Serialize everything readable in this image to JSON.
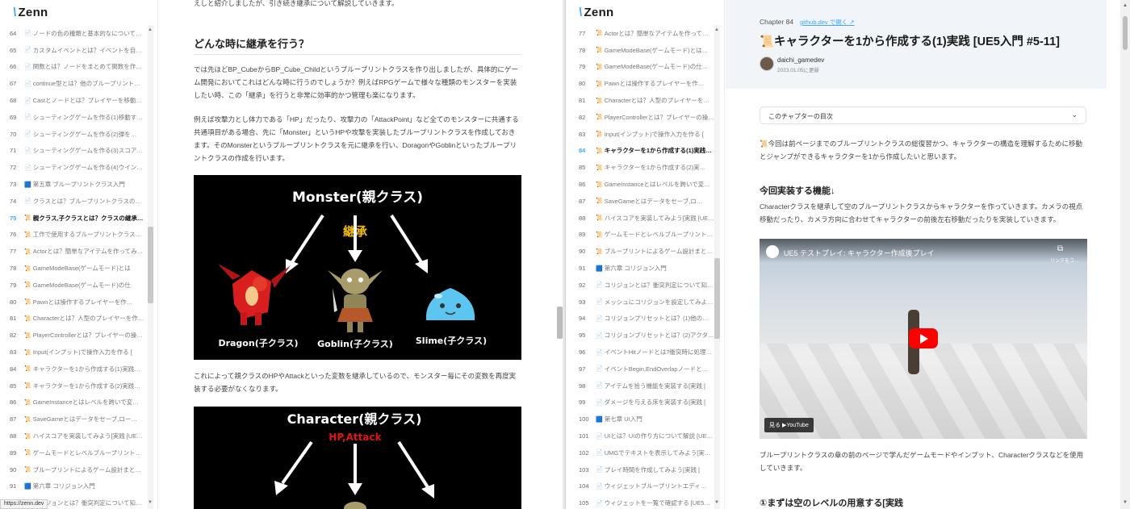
{
  "brand": {
    "slash": "\\",
    "name": "Zenn"
  },
  "left": {
    "chapters": [
      {
        "num": "64",
        "icon": "📄",
        "title": "ノードの色の種類と基本的なについて…",
        "active": false
      },
      {
        "num": "65",
        "icon": "📄",
        "title": "カスタムイベントとは？イベントを自…",
        "active": false
      },
      {
        "num": "66",
        "icon": "📄",
        "title": "関数とは？ノードをまとめて関数を作…",
        "active": false
      },
      {
        "num": "67",
        "icon": "📄",
        "title": "continue型とは？他のブループリントクラ…",
        "active": false
      },
      {
        "num": "68",
        "icon": "📄",
        "title": "Castとノードとは？プレイヤーを移動…",
        "active": false
      },
      {
        "num": "69",
        "icon": "📄",
        "title": "シューティングゲームを作る(1)移動す…",
        "active": false
      },
      {
        "num": "70",
        "icon": "📄",
        "title": "シューティングゲームを作る(2)弾を…",
        "active": false
      },
      {
        "num": "71",
        "icon": "📄",
        "title": "シューティングゲームを作る(3)スコア…",
        "active": false
      },
      {
        "num": "72",
        "icon": "📄",
        "title": "シューティングゲームを作る(4)ウイン…",
        "active": false
      },
      {
        "num": "73",
        "icon": "🟦",
        "title": "第五章 ブループリントクラス入門",
        "active": false
      },
      {
        "num": "74",
        "icon": "📄",
        "title": "クラスとは？ブループリントクラスの…",
        "active": false
      },
      {
        "num": "75",
        "icon": "📜",
        "title": "親クラス,子クラスとは？クラスの継承…",
        "active": true
      },
      {
        "num": "76",
        "icon": "📜",
        "title": "工作で使用するブループリントクラス…",
        "active": false
      },
      {
        "num": "77",
        "icon": "📜",
        "title": "Actorとは？簡単なアイテムを作ってみ…",
        "active": false
      },
      {
        "num": "78",
        "icon": "📜",
        "title": "GameModeBase(ゲームモード)とは",
        "active": false
      },
      {
        "num": "79",
        "icon": "📜",
        "title": "GameModeBase(ゲームモード)の仕",
        "active": false
      },
      {
        "num": "80",
        "icon": "📜",
        "title": "Pawnとは操作するプレイヤーを作…",
        "active": false
      },
      {
        "num": "81",
        "icon": "📜",
        "title": "Characterとは？人型のプレイヤーを作…",
        "active": false
      },
      {
        "num": "82",
        "icon": "📜",
        "title": "PlayerControllerとは？プレイヤーの操…",
        "active": false
      },
      {
        "num": "83",
        "icon": "📜",
        "title": "Input(インプット)で操作入力を作る [",
        "active": false
      },
      {
        "num": "84",
        "icon": "📜",
        "title": "キャラクターを1から作成する(1)実践…",
        "active": false
      },
      {
        "num": "85",
        "icon": "📜",
        "title": "キャラクターを1から作成する(2)実践…",
        "active": false
      },
      {
        "num": "86",
        "icon": "📜",
        "title": "GameInstanceとはレベルを跨いで変…",
        "active": false
      },
      {
        "num": "87",
        "icon": "📜",
        "title": "SaveGameとはデータをセーブ,ロー…",
        "active": false
      },
      {
        "num": "88",
        "icon": "📜",
        "title": "ハイスコアを実装してみよう[実践 [UE…",
        "active": false
      },
      {
        "num": "89",
        "icon": "📜",
        "title": "ゲームモードとレベルブループリント…",
        "active": false
      },
      {
        "num": "90",
        "icon": "📜",
        "title": "ブループリントによるゲーム設計まと…",
        "active": false
      },
      {
        "num": "91",
        "icon": "🟦",
        "title": "第六章 コリジョン入門",
        "active": false
      },
      {
        "num": "92",
        "icon": "📄",
        "title": "コリジョンとは？衝突判定について知…",
        "active": false
      }
    ],
    "article": {
      "intro_line": "えしと紹介しましたが、引き続き継承について解説していきます。",
      "heading": "どんな時に継承を行う？",
      "para1": "では先ほどBP_CubeからBP_Cube_Childというブループリントクラスを作り出しましたが、具体的にゲーム開発においてこれはどんな時に行うのでしょうか？例えばRPGゲームで様々な種類のモンスターを実装したい時、この「継承」を行うと非常に効率的かつ管理も楽になります。",
      "para2": "例えば攻撃力とし体力である「HP」だったり、攻撃力の「AttackPoint」など全てのモンスターに共通する共通項目がある場合、先に「Monster」というHPや攻撃を実装したブループリントクラスを作成しておきます。そのMonsterというブループリントクラスを元に継承を行い、DoragonやGoblinといったブループリントクラスの作成を行います。",
      "para3": "これによって親クラスのHPやAttackといった変数を継承しているので、モンスター毎にその変数を再度実装する必要がなくなります。",
      "figure1": {
        "parent": "Monster(親クラス)",
        "inherit": "継承",
        "child1": "Dragon(子クラス)",
        "child2": "Goblin(子クラス)",
        "child3": "Slime(子クラス)"
      },
      "figure2": {
        "parent": "Character(親クラス)",
        "vars": "HP,Attack"
      }
    },
    "status_url": "https://zenn.dev"
  },
  "right": {
    "chapters": [
      {
        "num": "77",
        "icon": "📜",
        "title": "Actorとは？簡単なアイテムを作ってみ…",
        "active": false
      },
      {
        "num": "78",
        "icon": "📜",
        "title": "GameModeBase(ゲームモード)とは…",
        "active": false
      },
      {
        "num": "79",
        "icon": "📜",
        "title": "GameModeBase(ゲームモード)の仕…",
        "active": false
      },
      {
        "num": "80",
        "icon": "📜",
        "title": "Pawnとは操作するプレイヤーを作…",
        "active": false
      },
      {
        "num": "81",
        "icon": "📜",
        "title": "Characterとは？人型のプレイヤーを作…",
        "active": false
      },
      {
        "num": "82",
        "icon": "📜",
        "title": "PlayerControllerとは？プレイヤーの操…",
        "active": false
      },
      {
        "num": "83",
        "icon": "📜",
        "title": "Input(インプット)で操作入力を作る [",
        "active": false
      },
      {
        "num": "84",
        "icon": "📜",
        "title": "キャラクターを1から作成する(1)実践…",
        "active": true
      },
      {
        "num": "85",
        "icon": "📜",
        "title": "キャラクターを1から作成する(2)実…",
        "active": false
      },
      {
        "num": "86",
        "icon": "📜",
        "title": "GameInstanceとはレベルを跨いで変…",
        "active": false
      },
      {
        "num": "87",
        "icon": "📜",
        "title": "SaveGameとはデータをセーブ,ロ…",
        "active": false
      },
      {
        "num": "88",
        "icon": "📜",
        "title": "ハイスコアを実装してみよう[実践 [UE…",
        "active": false
      },
      {
        "num": "89",
        "icon": "📜",
        "title": "ゲームモードとレベルブループリント…",
        "active": false
      },
      {
        "num": "90",
        "icon": "📜",
        "title": "ブループリントによるゲーム設計まと…",
        "active": false
      },
      {
        "num": "91",
        "icon": "🟦",
        "title": "第六章 コリジョン入門",
        "active": false
      },
      {
        "num": "92",
        "icon": "📄",
        "title": "コリジョンとは？衝突判定について知…",
        "active": false
      },
      {
        "num": "93",
        "icon": "📄",
        "title": "メッシュにコリジョンを設定してみよ…",
        "active": false
      },
      {
        "num": "94",
        "icon": "📄",
        "title": "コリジョンプリセットとは？(1)他のア…",
        "active": false
      },
      {
        "num": "95",
        "icon": "📄",
        "title": "コリジョンプリセットとは？(2)アクタ…",
        "active": false
      },
      {
        "num": "96",
        "icon": "📄",
        "title": "イベントHitノードとは?衝突時に処理…",
        "active": false
      },
      {
        "num": "97",
        "icon": "📄",
        "title": "イベントBegin,EndOverlapノードと…",
        "active": false
      },
      {
        "num": "98",
        "icon": "📄",
        "title": "アイテムを拾う機能を実装する[実践 [",
        "active": false
      },
      {
        "num": "99",
        "icon": "📄",
        "title": "ダメージを与える床を実装する[実践 [",
        "active": false
      },
      {
        "num": "100",
        "icon": "🟦",
        "title": "第七章 UI入門",
        "active": false
      },
      {
        "num": "101",
        "icon": "📄",
        "title": "UIとは？UIの作り方について解説 [UE…",
        "active": false
      },
      {
        "num": "102",
        "icon": "📄",
        "title": "UMGでテキストを表示してみよう[実…",
        "active": false
      },
      {
        "num": "103",
        "icon": "📄",
        "title": "プレイ時間を作成してみよう[実践 [",
        "active": false
      },
      {
        "num": "104",
        "icon": "📄",
        "title": "ウィジェットブループリントエディ…",
        "active": false
      },
      {
        "num": "105",
        "icon": "📄",
        "title": "ウィジェットを一覧で確認する [UE5…",
        "active": false
      }
    ],
    "header": {
      "chapter_label": "Chapter 84",
      "github_link": "github.dev で開く ↗",
      "title": "📜キャラクターを1から作成する(1)実践 [UE5入門 #5-11]",
      "author": "daichi_gamedev",
      "date": "2023.01.05に更新"
    },
    "toc_label": "このチャプターの目次",
    "intro": "📜今回は前ページまでのブループリントクラスの総復習かつ、キャラクターの構造を理解するために移動とジャンプができるキャラクターを1から作成したいと思います。",
    "feature_heading": "今回実装する機能↓",
    "feature_text": "Characterクラスを継承して空のブループリントクラスからキャラクターを作っていきます。カメラの視点移動だったり、カメラ方向に合わせてキャラクターの前後左右移動だったりを実装していきます。",
    "video": {
      "title": "UE5 テストプレイ: キャラクター作成後プレイ",
      "copy_label": "リンクをコ…",
      "watch_on": "見る ▶YouTube"
    },
    "after_video": "ブループリントクラスの章の前のページで学んだゲームモードやインプット、Characterクラスなどを使用していきます。",
    "step1_heading": "①まずは空のレベルの用意する[実践"
  }
}
